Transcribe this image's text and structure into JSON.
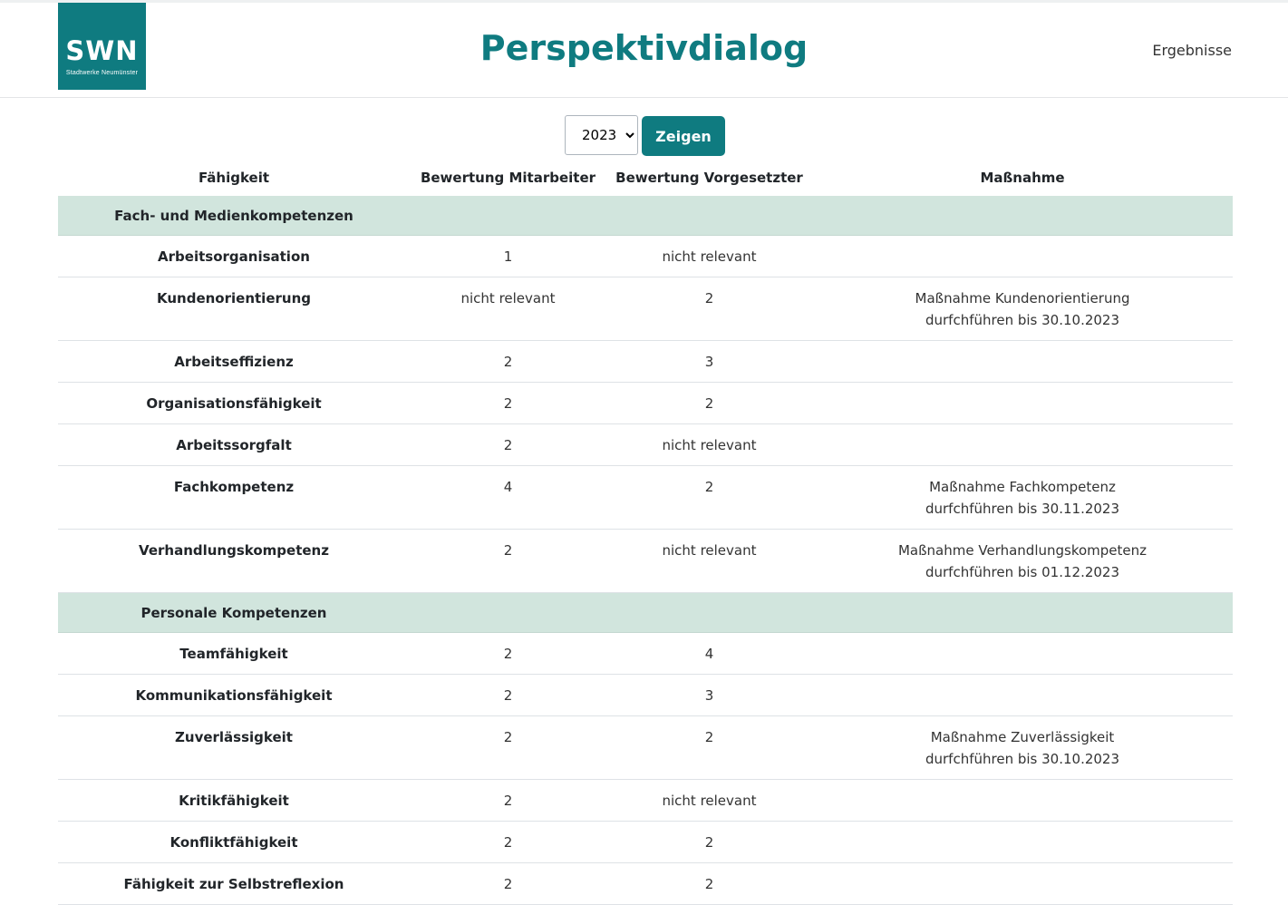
{
  "header": {
    "logo_text": "SWN",
    "logo_subtext": "Stadtwerke Neumünster",
    "title": "Perspektivdialog",
    "nav_link": "Ergebnisse"
  },
  "controls": {
    "year_selected": "2023",
    "year_options": [
      "2023"
    ],
    "show_button": "Zeigen"
  },
  "table": {
    "headers": [
      "Fähigkeit",
      "Bewertung Mitarbeiter",
      "Bewertung Vorgesetzter",
      "Maßnahme"
    ],
    "groups": [
      {
        "name": "Fach- und Medienkompetenzen",
        "rows": [
          {
            "skill": "Arbeitsorganisation",
            "employee": "1",
            "supervisor": "nicht relevant",
            "measure": ""
          },
          {
            "skill": "Kundenorientierung",
            "employee": "nicht relevant",
            "supervisor": "2",
            "measure": "Maßnahme Kundenorientierung\ndurfchführen bis 30.10.2023"
          },
          {
            "skill": "Arbeitseffizienz",
            "employee": "2",
            "supervisor": "3",
            "measure": ""
          },
          {
            "skill": "Organisationsfähigkeit",
            "employee": "2",
            "supervisor": "2",
            "measure": ""
          },
          {
            "skill": "Arbeitssorgfalt",
            "employee": "2",
            "supervisor": "nicht relevant",
            "measure": ""
          },
          {
            "skill": "Fachkompetenz",
            "employee": "4",
            "supervisor": "2",
            "measure": "Maßnahme Fachkompetenz\ndurfchführen bis 30.11.2023"
          },
          {
            "skill": "Verhandlungskompetenz",
            "employee": "2",
            "supervisor": "nicht relevant",
            "measure": "Maßnahme Verhandlungskompetenz\ndurfchführen bis 01.12.2023"
          }
        ]
      },
      {
        "name": "Personale Kompetenzen",
        "rows": [
          {
            "skill": "Teamfähigkeit",
            "employee": "2",
            "supervisor": "4",
            "measure": ""
          },
          {
            "skill": "Kommunikationsfähigkeit",
            "employee": "2",
            "supervisor": "3",
            "measure": ""
          },
          {
            "skill": "Zuverlässigkeit",
            "employee": "2",
            "supervisor": "2",
            "measure": "Maßnahme Zuverlässigkeit\ndurfchführen bis 30.10.2023"
          },
          {
            "skill": "Kritikfähigkeit",
            "employee": "2",
            "supervisor": "nicht relevant",
            "measure": ""
          },
          {
            "skill": "Konfliktfähigkeit",
            "employee": "2",
            "supervisor": "2",
            "measure": ""
          },
          {
            "skill": "Fähigkeit zur Selbstreflexion",
            "employee": "2",
            "supervisor": "2",
            "measure": ""
          }
        ]
      }
    ]
  },
  "colors": {
    "brand": "#0f7b80",
    "group_row_bg": "#d1e5dd"
  }
}
